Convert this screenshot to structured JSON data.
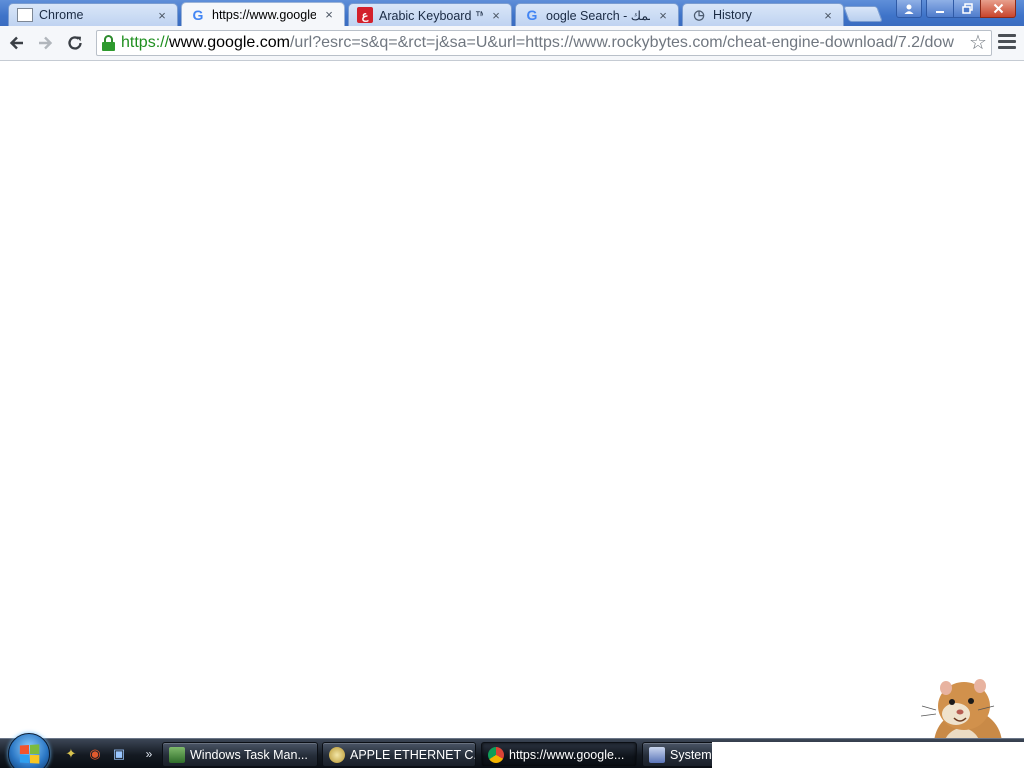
{
  "browser": {
    "tabs": [
      {
        "label": "Chrome",
        "icon": "page-icon",
        "active": false
      },
      {
        "label": "https://www.google.",
        "icon": "google-icon",
        "active": true
      },
      {
        "label": "Arabic Keyboard ™ ع",
        "icon": "arabic-keyboard-icon",
        "active": false
      },
      {
        "label": "oogle Search - كسمك",
        "icon": "google-icon",
        "active": false
      },
      {
        "label": "History",
        "icon": "history-icon",
        "active": false
      }
    ],
    "close_glyph": "×",
    "address_bar": {
      "scheme": "https://",
      "host": "www.google.com",
      "path": "/url?esrc=s&q=&rct=j&sa=U&url=https://www.rockybytes.com/cheat-engine-download/7.2/dow",
      "secure": true
    },
    "colors": {
      "secure_green": "#1f8f1f",
      "tabstrip_blue": "#3f74c9",
      "close_red": "#c8452c"
    }
  },
  "taskbar": {
    "tasks": [
      {
        "label": "Windows Task Man...",
        "icon": "task-manager-icon",
        "active": false
      },
      {
        "label": "APPLE ETHERNET C...",
        "icon": "ethernet-icon",
        "active": false
      },
      {
        "label": "https://www.google...",
        "icon": "chrome-icon",
        "active": true
      },
      {
        "label": "System P...",
        "icon": "system-icon",
        "active": false
      }
    ]
  }
}
